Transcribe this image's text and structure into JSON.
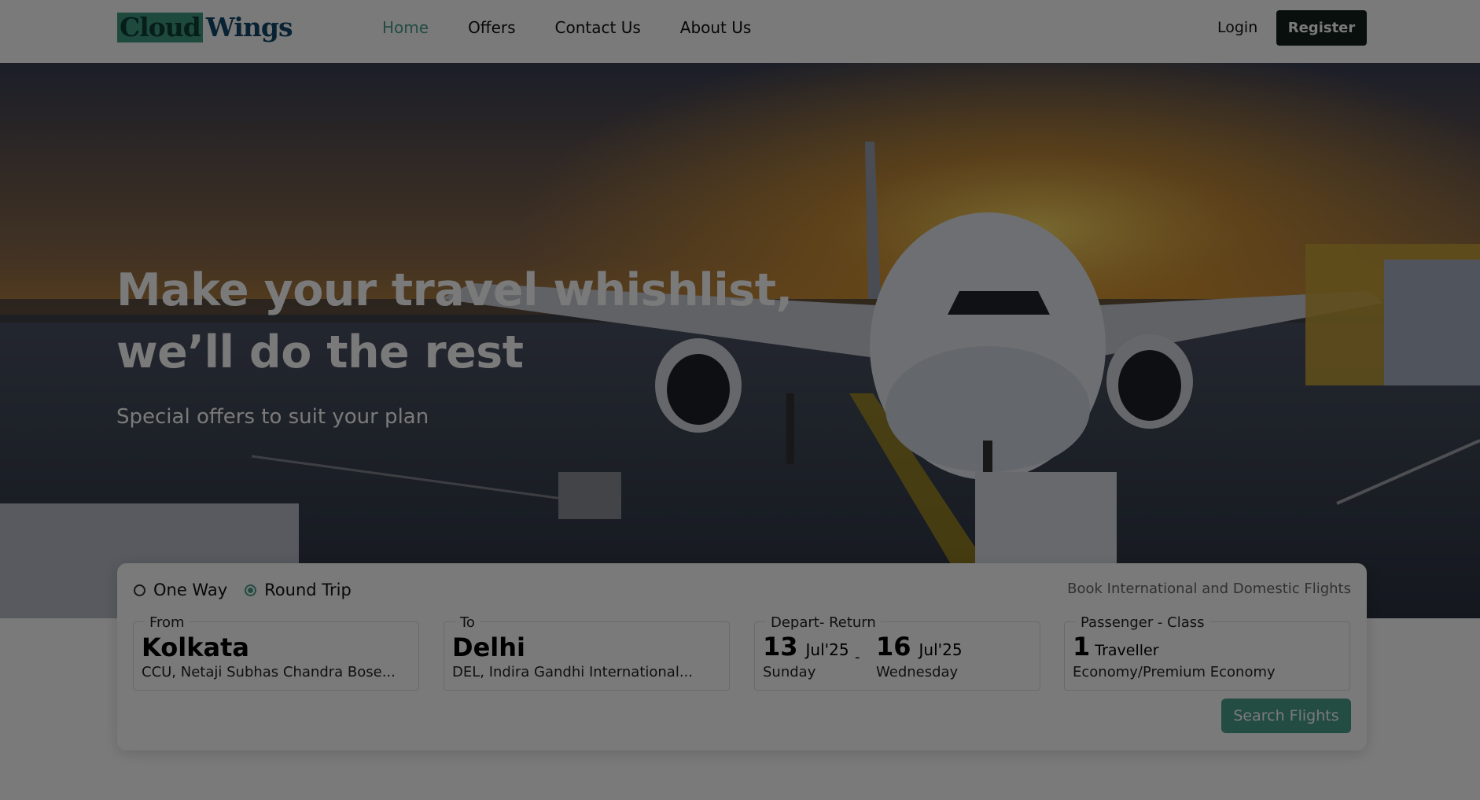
{
  "brand": {
    "part1": "Cloud",
    "part2": "Wings"
  },
  "nav": {
    "links": [
      "Home",
      "Offers",
      "Contact Us",
      "About Us"
    ],
    "login": "Login",
    "register": "Register"
  },
  "hero": {
    "title_line1": "Make your travel whishlist,",
    "title_line2": "we’ll do the rest",
    "subtitle": "Special offers to suit your plan"
  },
  "search": {
    "trip_types": [
      {
        "label": "One Way",
        "selected": false
      },
      {
        "label": "Round Trip",
        "selected": true
      }
    ],
    "tagline": "Book International and Domestic Flights",
    "from": {
      "legend": "From",
      "city": "Kolkata",
      "airport": "CCU, Netaji Subhas Chandra Bose..."
    },
    "to": {
      "legend": "To",
      "city": "Delhi",
      "airport": "DEL, Indira Gandhi International..."
    },
    "dates": {
      "legend": "Depart- Return",
      "separator": "-",
      "depart": {
        "day": "13",
        "month": "Jul'25",
        "weekday": "Sunday"
      },
      "return": {
        "day": "16",
        "month": "Jul'25",
        "weekday": "Wednesday"
      }
    },
    "passengers": {
      "legend": "Passenger - Class",
      "count": "1",
      "label": "Traveller",
      "class": "Economy/Premium Economy"
    },
    "button": "Search Flights"
  },
  "colors": {
    "accent": "#4a9f8a",
    "dark": "#11201c",
    "overlay": "rgba(0,0,0,0.52)"
  },
  "icons": {
    "plane_photo": "airplane-on-runway-at-sunset"
  }
}
